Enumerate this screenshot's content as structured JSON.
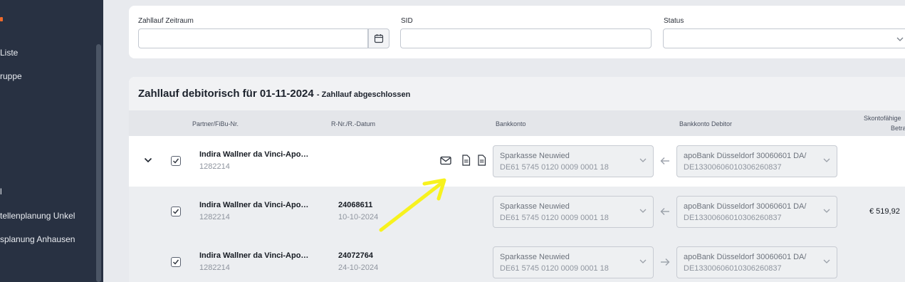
{
  "sidebar": {
    "items": [
      {
        "label": "Liste"
      },
      {
        "label": "ruppe"
      },
      {
        "label": "l"
      },
      {
        "label": "tellenplanung Unkel"
      },
      {
        "label": "splanung Anhausen"
      }
    ]
  },
  "filters": {
    "zeitraum_label": "Zahllauf Zeitraum",
    "zeitraum_value": "",
    "sid_label": "SID",
    "sid_value": "",
    "status_label": "Status",
    "status_value": ""
  },
  "panel": {
    "title": "Zahllauf debitorisch für 01-11-2024",
    "subtitle": "- Zahllauf abgeschlossen"
  },
  "columns": {
    "partner": "Partner/FiBu-Nr.",
    "rnr": "R-Nr./R.-Datum",
    "bankkonto": "Bankkonto",
    "bankkonto_debitor": "Bankkonto Debitor",
    "skonto_line1": "Skontofähige",
    "skonto_line2": "Betra"
  },
  "rows": [
    {
      "partner_name": "Indira Wallner da Vinci-Apo…",
      "partner_id": "1282214",
      "rnr": "",
      "rdate": "",
      "bank_name": "Sparkasse Neuwied",
      "bank_iban": "DE61 5745 0120 0009 0001 18",
      "debitor_name": "apoBank Düsseldorf 30060601 DA/",
      "debitor_iban": "DE13300606010306260837",
      "direction": "left",
      "amount": ""
    },
    {
      "partner_name": "Indira Wallner da Vinci-Apo…",
      "partner_id": "1282214",
      "rnr": "24068611",
      "rdate": "10-10-2024",
      "bank_name": "Sparkasse Neuwied",
      "bank_iban": "DE61 5745 0120 0009 0001 18",
      "debitor_name": "apoBank Düsseldorf 30060601 DA/",
      "debitor_iban": "DE13300606010306260837",
      "direction": "left",
      "amount": "€ 519,92"
    },
    {
      "partner_name": "Indira Wallner da Vinci-Apo…",
      "partner_id": "1282214",
      "rnr": "24072764",
      "rdate": "24-10-2024",
      "bank_name": "Sparkasse Neuwied",
      "bank_iban": "DE61 5745 0120 0009 0001 18",
      "debitor_name": "apoBank Düsseldorf 30060601 DA/",
      "debitor_iban": "DE13300606010306260837",
      "direction": "right",
      "amount": ""
    }
  ],
  "icons": {
    "accent_color": "#ef6a2b",
    "annotation_color": "#f7f21e",
    "row_actions": [
      "mail-icon",
      "document-icon",
      "document-icon"
    ],
    "calendar": "calendar-icon",
    "expand": "chevron-down-icon"
  }
}
